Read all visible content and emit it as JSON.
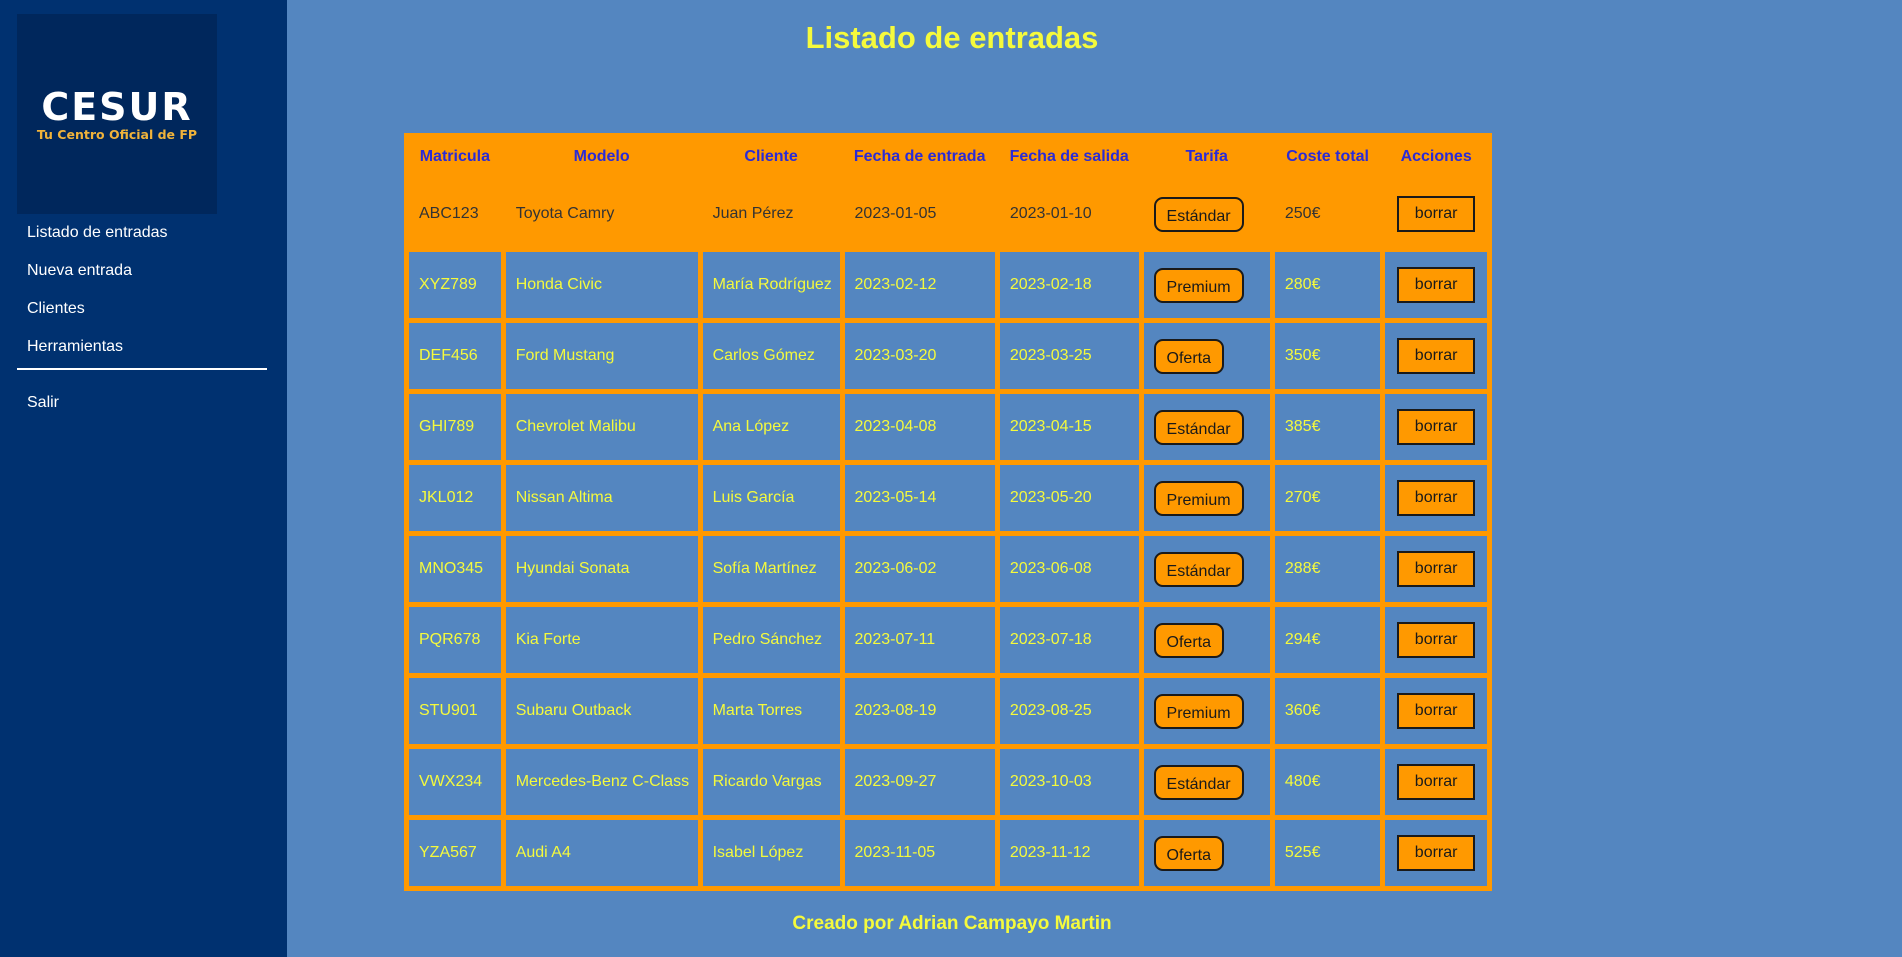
{
  "sidebar": {
    "logo": {
      "title": "CESUR",
      "subtitle": "Tu Centro Oficial de FP"
    },
    "items": [
      {
        "label": "Listado de entradas"
      },
      {
        "label": "Nueva entrada"
      },
      {
        "label": "Clientes"
      },
      {
        "label": "Herramientas"
      }
    ],
    "logout_label": "Salir"
  },
  "page": {
    "title": "Listado de entradas",
    "footer": "Creado por Adrian Campayo Martin"
  },
  "table": {
    "headers": [
      "Matricula",
      "Modelo",
      "Cliente",
      "Fecha de entrada",
      "Fecha de salida",
      "Tarifa",
      "Coste total",
      "Acciones"
    ],
    "rows": [
      {
        "matricula": "ABC123",
        "modelo": "Toyota Camry",
        "cliente": "Juan Pérez",
        "entrada": "2023-01-05",
        "salida": "2023-01-10",
        "tarifa": "Estándar",
        "coste": "250€",
        "accion": "borrar"
      },
      {
        "matricula": "XYZ789",
        "modelo": "Honda Civic",
        "cliente": "María Rodríguez",
        "entrada": "2023-02-12",
        "salida": "2023-02-18",
        "tarifa": "Premium",
        "coste": "280€",
        "accion": "borrar"
      },
      {
        "matricula": "DEF456",
        "modelo": "Ford Mustang",
        "cliente": "Carlos Gómez",
        "entrada": "2023-03-20",
        "salida": "2023-03-25",
        "tarifa": "Oferta",
        "coste": "350€",
        "accion": "borrar"
      },
      {
        "matricula": "GHI789",
        "modelo": "Chevrolet Malibu",
        "cliente": "Ana López",
        "entrada": "2023-04-08",
        "salida": "2023-04-15",
        "tarifa": "Estándar",
        "coste": "385€",
        "accion": "borrar"
      },
      {
        "matricula": "JKL012",
        "modelo": "Nissan Altima",
        "cliente": "Luis García",
        "entrada": "2023-05-14",
        "salida": "2023-05-20",
        "tarifa": "Premium",
        "coste": "270€",
        "accion": "borrar"
      },
      {
        "matricula": "MNO345",
        "modelo": "Hyundai Sonata",
        "cliente": "Sofía Martínez",
        "entrada": "2023-06-02",
        "salida": "2023-06-08",
        "tarifa": "Estándar",
        "coste": "288€",
        "accion": "borrar"
      },
      {
        "matricula": "PQR678",
        "modelo": "Kia Forte",
        "cliente": "Pedro Sánchez",
        "entrada": "2023-07-11",
        "salida": "2023-07-18",
        "tarifa": "Oferta",
        "coste": "294€",
        "accion": "borrar"
      },
      {
        "matricula": "STU901",
        "modelo": "Subaru Outback",
        "cliente": "Marta Torres",
        "entrada": "2023-08-19",
        "salida": "2023-08-25",
        "tarifa": "Premium",
        "coste": "360€",
        "accion": "borrar"
      },
      {
        "matricula": "VWX234",
        "modelo": "Mercedes-Benz C-Class",
        "cliente": "Ricardo Vargas",
        "entrada": "2023-09-27",
        "salida": "2023-10-03",
        "tarifa": "Estándar",
        "coste": "480€",
        "accion": "borrar"
      },
      {
        "matricula": "YZA567",
        "modelo": "Audi A4",
        "cliente": "Isabel López",
        "entrada": "2023-11-05",
        "salida": "2023-11-12",
        "tarifa": "Oferta",
        "coste": "525€",
        "accion": "borrar"
      }
    ]
  },
  "colors": {
    "background": "#5486c0",
    "sidebar": "#003170",
    "accent_orange": "#ff9900",
    "text_yellow": "#f5fa3c",
    "header_blue": "#2b2bd6"
  }
}
